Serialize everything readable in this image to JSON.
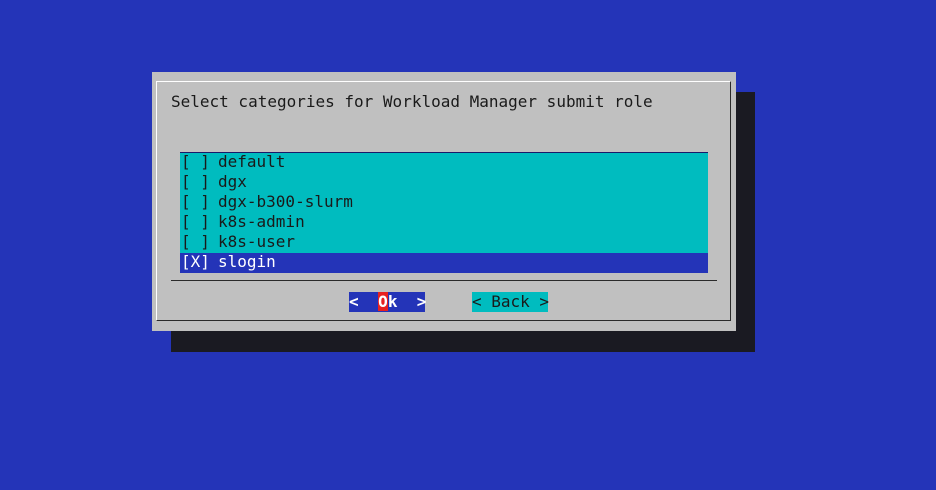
{
  "dialog": {
    "title": "Select categories for Workload Manager submit role",
    "items": [
      {
        "checkbox": "[ ]",
        "label": "default",
        "checked": false
      },
      {
        "checkbox": "[ ]",
        "label": "dgx",
        "checked": false
      },
      {
        "checkbox": "[ ]",
        "label": "dgx-b300-slurm",
        "checked": false
      },
      {
        "checkbox": "[ ]",
        "label": "k8s-admin",
        "checked": false
      },
      {
        "checkbox": "[ ]",
        "label": "k8s-user",
        "checked": false
      },
      {
        "checkbox": "[X]",
        "label": "slogin",
        "checked": true
      }
    ],
    "buttons": {
      "ok_prefix": "<  ",
      "ok_hot": "O",
      "ok_rest": "k  >",
      "back_label": "< Back >"
    }
  },
  "colors": {
    "background": "#2434b8",
    "dialog": "#c0c0c0",
    "list": "#00bcbf",
    "selected": "#2434b8",
    "hotkey": "#e82020"
  }
}
